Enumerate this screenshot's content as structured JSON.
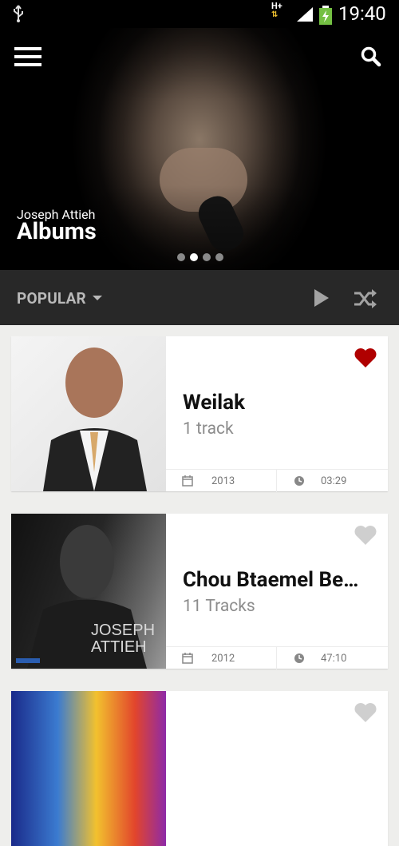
{
  "status_bar": {
    "network": "H+",
    "time": "19:40"
  },
  "hero": {
    "artist": "Joseph Attieh",
    "title": "Albums",
    "page_dots": 4,
    "active_dot": 1
  },
  "toolbar": {
    "sort_label": "POPULAR"
  },
  "albums": [
    {
      "name": "Weilak",
      "tracks": "1 track",
      "year": "2013",
      "duration": "03:29",
      "favorite": true
    },
    {
      "name": "Chou Btaemel Be…",
      "tracks": "11 Tracks",
      "year": "2012",
      "duration": "47:10",
      "favorite": false
    }
  ],
  "cover_text": {
    "line1": "JOSEPH",
    "line2": "ATTIEH"
  },
  "colors": {
    "favorite": "#b00000",
    "not_favorite": "#cfcfcf"
  }
}
